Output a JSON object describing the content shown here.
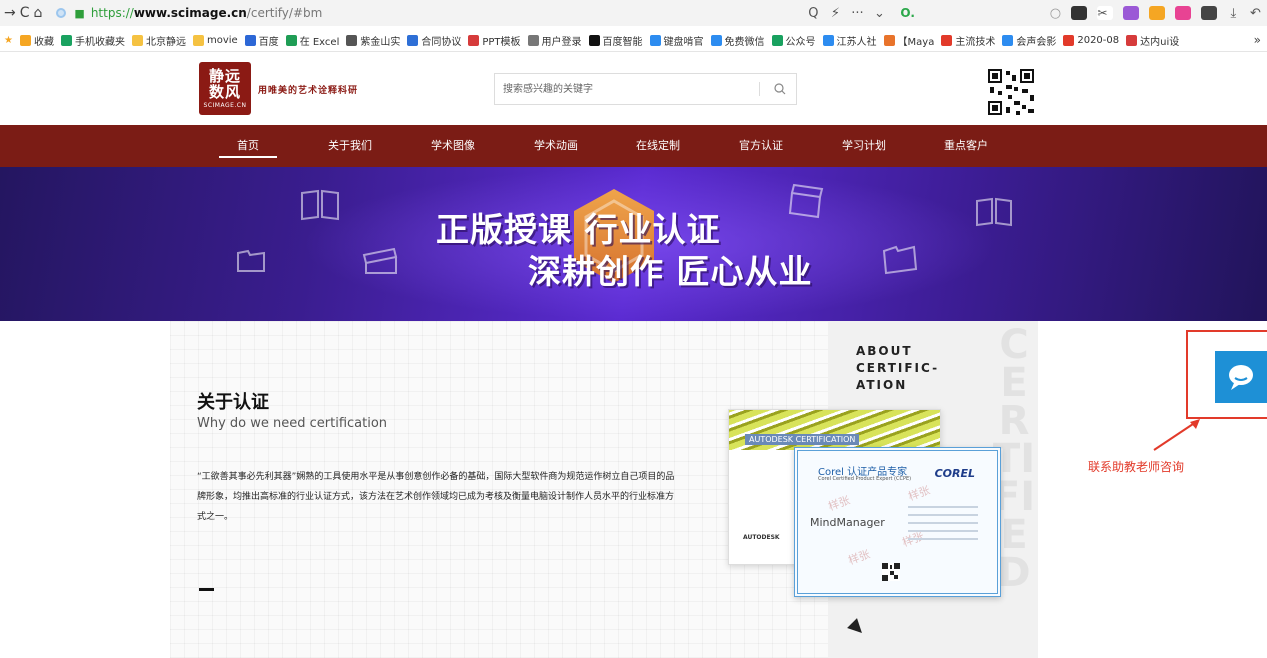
{
  "browser": {
    "url_scheme": "https://",
    "url_host": "www.scimage.cn",
    "url_path": "/certify/#bm",
    "search_engine_icon": "O.",
    "bookmarks": [
      "收藏",
      "手机收藏夹",
      "北京静远",
      "movie",
      "百度",
      "在 Excel",
      "紫金山实",
      "合同协议",
      "PPT模板",
      "用户登录",
      "百度智能",
      "键盘啃官",
      "免费微信",
      "公众号",
      "江苏人社",
      "【Maya",
      "主流技术",
      "会声会影",
      "2020-08",
      "达内ui设"
    ],
    "bookmark_colors": [
      "#f5a623",
      "#1aa260",
      "#f5c242",
      "#f5c242",
      "#2c67d6",
      "#1f9d55",
      "#555555",
      "#2e6fd6",
      "#d63b3b",
      "#777777",
      "#111111",
      "#2d8cf0",
      "#2d8cf0",
      "#19a15f",
      "#2d8cf0",
      "#e8732b",
      "#e23a2a",
      "#2d8cf0",
      "#e23a2a",
      "#d63b3b"
    ],
    "more_label": "»"
  },
  "header": {
    "logo_line1": "静远",
    "logo_line2": "数风",
    "logo_domain": "SCIMAGE.CN",
    "slogan": "用唯美的艺术诠释科研",
    "search_placeholder": "搜索感兴趣的关键字"
  },
  "nav": {
    "items": [
      "首页",
      "关于我们",
      "学术图像",
      "学术动画",
      "在线定制",
      "官方认证",
      "学习计划",
      "重点客户"
    ],
    "active_index": 0
  },
  "banner": {
    "line1": "正版授课 行业认证",
    "line2": "深耕创作 匠心从业"
  },
  "section": {
    "title": "关于认证",
    "subtitle": "Why do we need certification",
    "body": "“工欲善其事必先利其器”娴熟的工具使用水平是从事创意创作必备的基础，国际大型软件商为规范运作树立自己项目的品牌形象，均推出高标准的行业认证方式，该方法在艺术创作领域均已成为考核及衡量电脑设计制作人员水平的行业标准方式之一。",
    "about_line1": "ABOUT",
    "about_line2": "CERTIFIC-",
    "about_line3": "ATION",
    "vertical_word": "CERTIFIED"
  },
  "certificates": {
    "back_tag": "AUTODESK CERTIFICATION",
    "back_logo": "AUTODESK",
    "front_title": "Corel 认证产品专家",
    "front_sub": "Corel Certified Product Expert (CCPE)",
    "front_logo": "COREL",
    "front_product": "MindManager",
    "watermark": "样张"
  },
  "chat": {
    "contact_label": "联系助教老师咨询",
    "accent": "#1e90d6",
    "highlight": "#e23a2a"
  },
  "colors": {
    "brand_red": "#7b1c15",
    "banner_purple": "#3a1d8f"
  }
}
